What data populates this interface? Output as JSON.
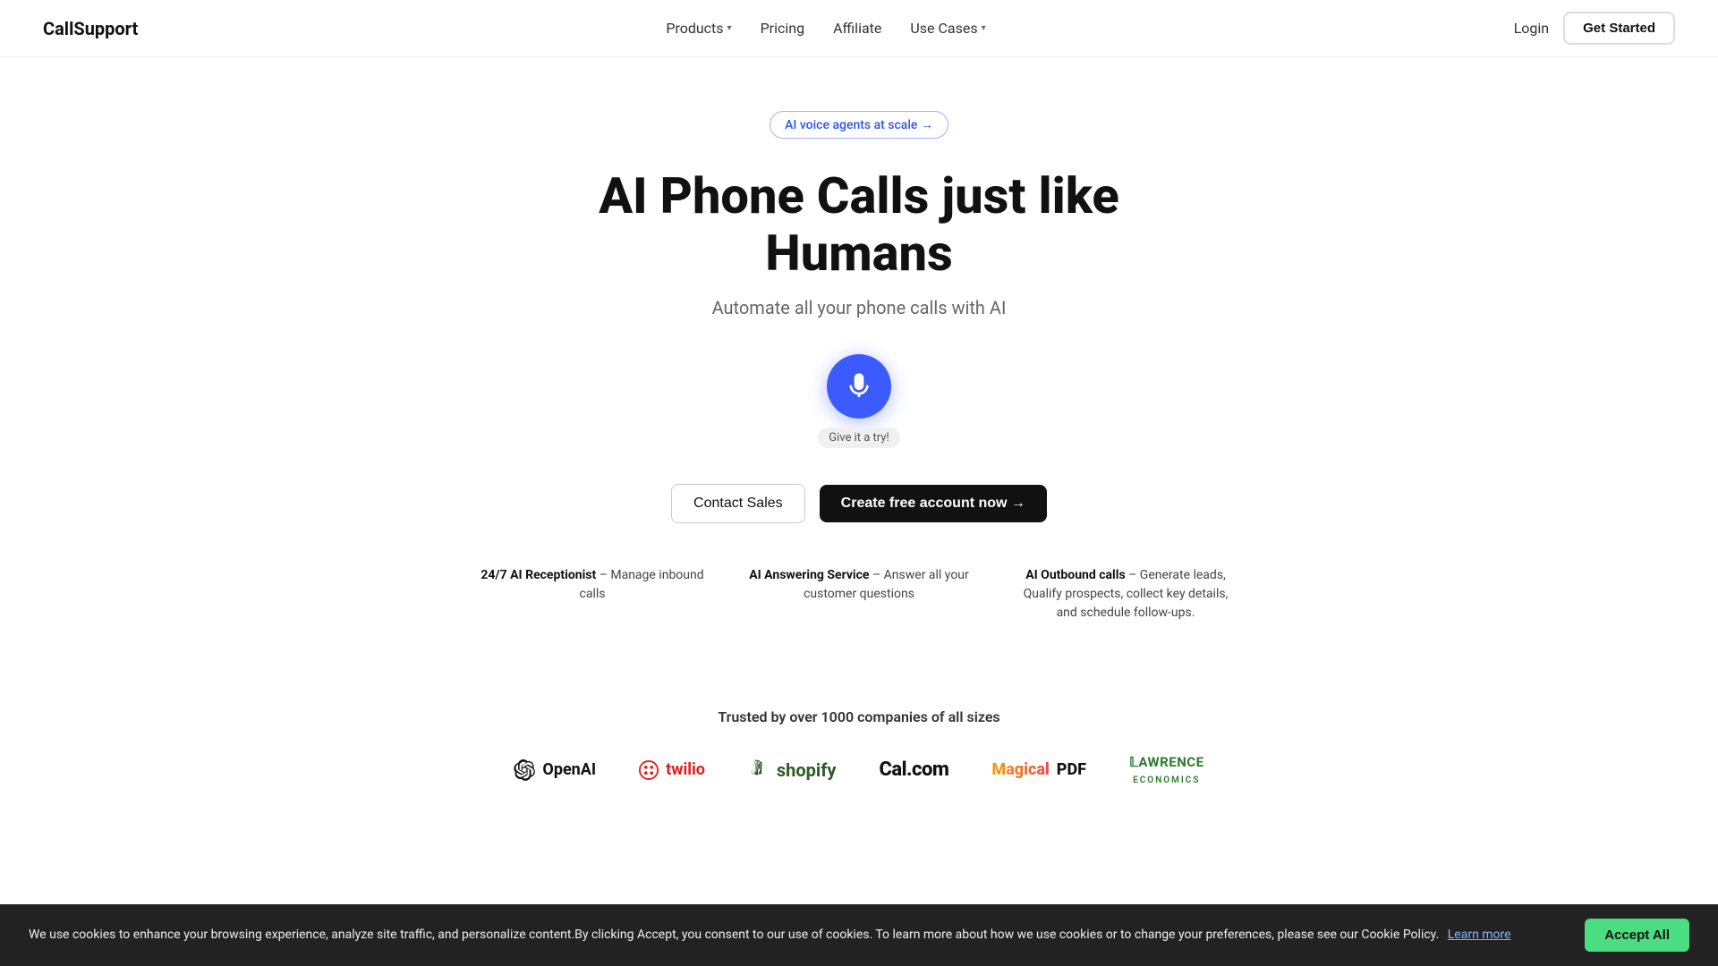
{
  "nav": {
    "logo": "CallSupport",
    "links": [
      {
        "label": "Products",
        "hasDropdown": true
      },
      {
        "label": "Pricing",
        "hasDropdown": false
      },
      {
        "label": "Affiliate",
        "hasDropdown": false
      },
      {
        "label": "Use Cases",
        "hasDropdown": true
      }
    ],
    "login": "Login",
    "getStarted": "Get Started"
  },
  "hero": {
    "badge": "AI voice agents at scale →",
    "title": "AI Phone Calls just like Humans",
    "subtitle": "Automate all your phone calls with AI",
    "micLabel": "Give it a try!",
    "ctaContact": "Contact Sales",
    "ctaCreate": "Create free account now →"
  },
  "features": [
    {
      "name": "24/7 AI Receptionist",
      "separator": "–",
      "desc": "Manage inbound calls"
    },
    {
      "name": "AI Answering Service",
      "separator": "–",
      "desc": "Answer all your customer questions"
    },
    {
      "name": "AI Outbound calls",
      "separator": "–",
      "desc": "Generate leads, Qualify prospects, collect key details, and schedule follow-ups."
    }
  ],
  "trusted": {
    "title": "Trusted by over 1000 companies of all sizes",
    "logos": [
      {
        "name": "OpenAI",
        "type": "openai"
      },
      {
        "name": "twilio",
        "type": "twilio"
      },
      {
        "name": "shopify",
        "type": "shopify"
      },
      {
        "name": "Cal.com",
        "type": "calcom"
      },
      {
        "name": "MagicalPDF",
        "type": "magical"
      },
      {
        "name": "LAWRENCE ECONOMICS",
        "type": "lawrence"
      }
    ]
  },
  "cookie": {
    "text": "We use cookies to enhance your browsing experience, analyze site traffic, and personalize content.By clicking Accept, you consent to our use of cookies. To learn more about how we use cookies or to change your preferences, please see our Cookie Policy.",
    "learnMore": "Learn more",
    "accept": "Accept All"
  }
}
